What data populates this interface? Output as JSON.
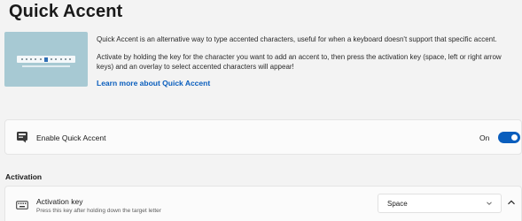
{
  "page": {
    "title": "Quick Accent"
  },
  "intro": {
    "paragraph1": "Quick Accent is an alternative way to type accented characters, useful for when a keyboard doesn't support that specific accent.",
    "paragraph2": "Activate by holding the key for the character you want to add an accent to, then press the activation key (space, left or right arrow keys) and an overlay to select accented characters will appear!",
    "learn_more_link": "Learn more about Quick Accent"
  },
  "enable": {
    "icon": "quick-accent-icon",
    "label": "Enable Quick Accent",
    "toggle_state": "On",
    "toggle_on": true
  },
  "activation": {
    "section_title": "Activation",
    "icon": "keyboard-icon",
    "title": "Activation key",
    "subtitle": "Press this key after holding down the target letter",
    "selected_option": "Space"
  },
  "colors": {
    "accent": "#0a5ebd",
    "background": "#f3f3f3",
    "card": "#fbfbfb",
    "hero": "#a7c9d3"
  }
}
